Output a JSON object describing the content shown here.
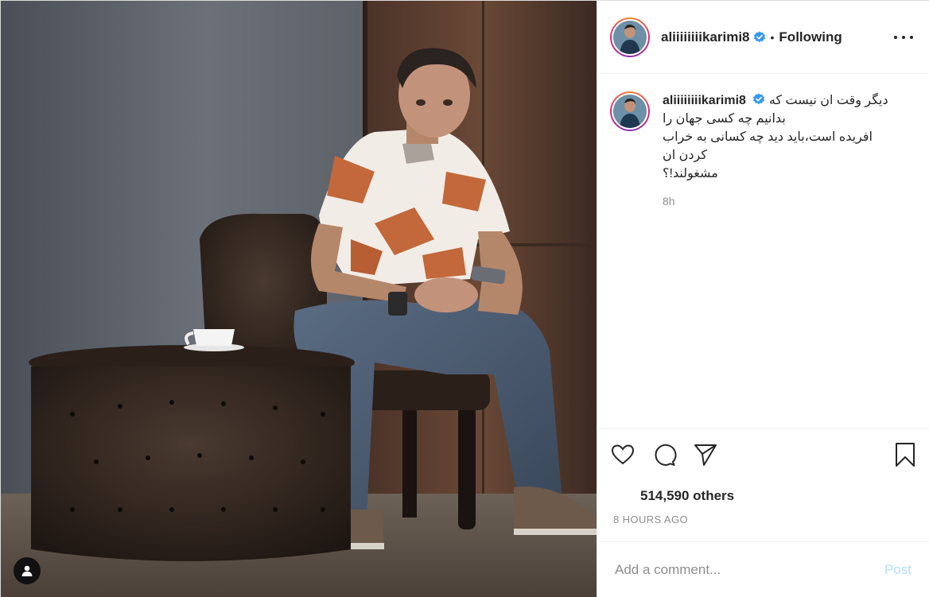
{
  "header": {
    "username": "aliiiiiiiikarimi8",
    "separator": "•",
    "follow_status": "Following"
  },
  "caption": {
    "username": "aliiiiiiiikarimi8",
    "lines": [
      "دیگر وقت ان نیست که",
      "بدانیم چه کسی جهان را",
      "افریده است،باید دید چه کسانی به خراب",
      "کردن ان",
      "مشغولند!؟"
    ],
    "time": "8h"
  },
  "actions": {
    "likes": "514,590 others",
    "post_time": "8 HOURS AGO"
  },
  "comment_box": {
    "placeholder": "Add a comment...",
    "post_label": "Post"
  },
  "icons": {
    "like": "heart-icon",
    "comment": "comment-icon",
    "share": "paper-plane-icon",
    "save": "bookmark-icon",
    "more": "more-options-icon",
    "verified": "verified-badge-icon",
    "user_tag": "user-tag-icon"
  },
  "colors": {
    "verified": "#3897f0",
    "post_button_disabled": "#b2dffc",
    "secondary_text": "#8e8e8e",
    "primary_text": "#262626"
  }
}
